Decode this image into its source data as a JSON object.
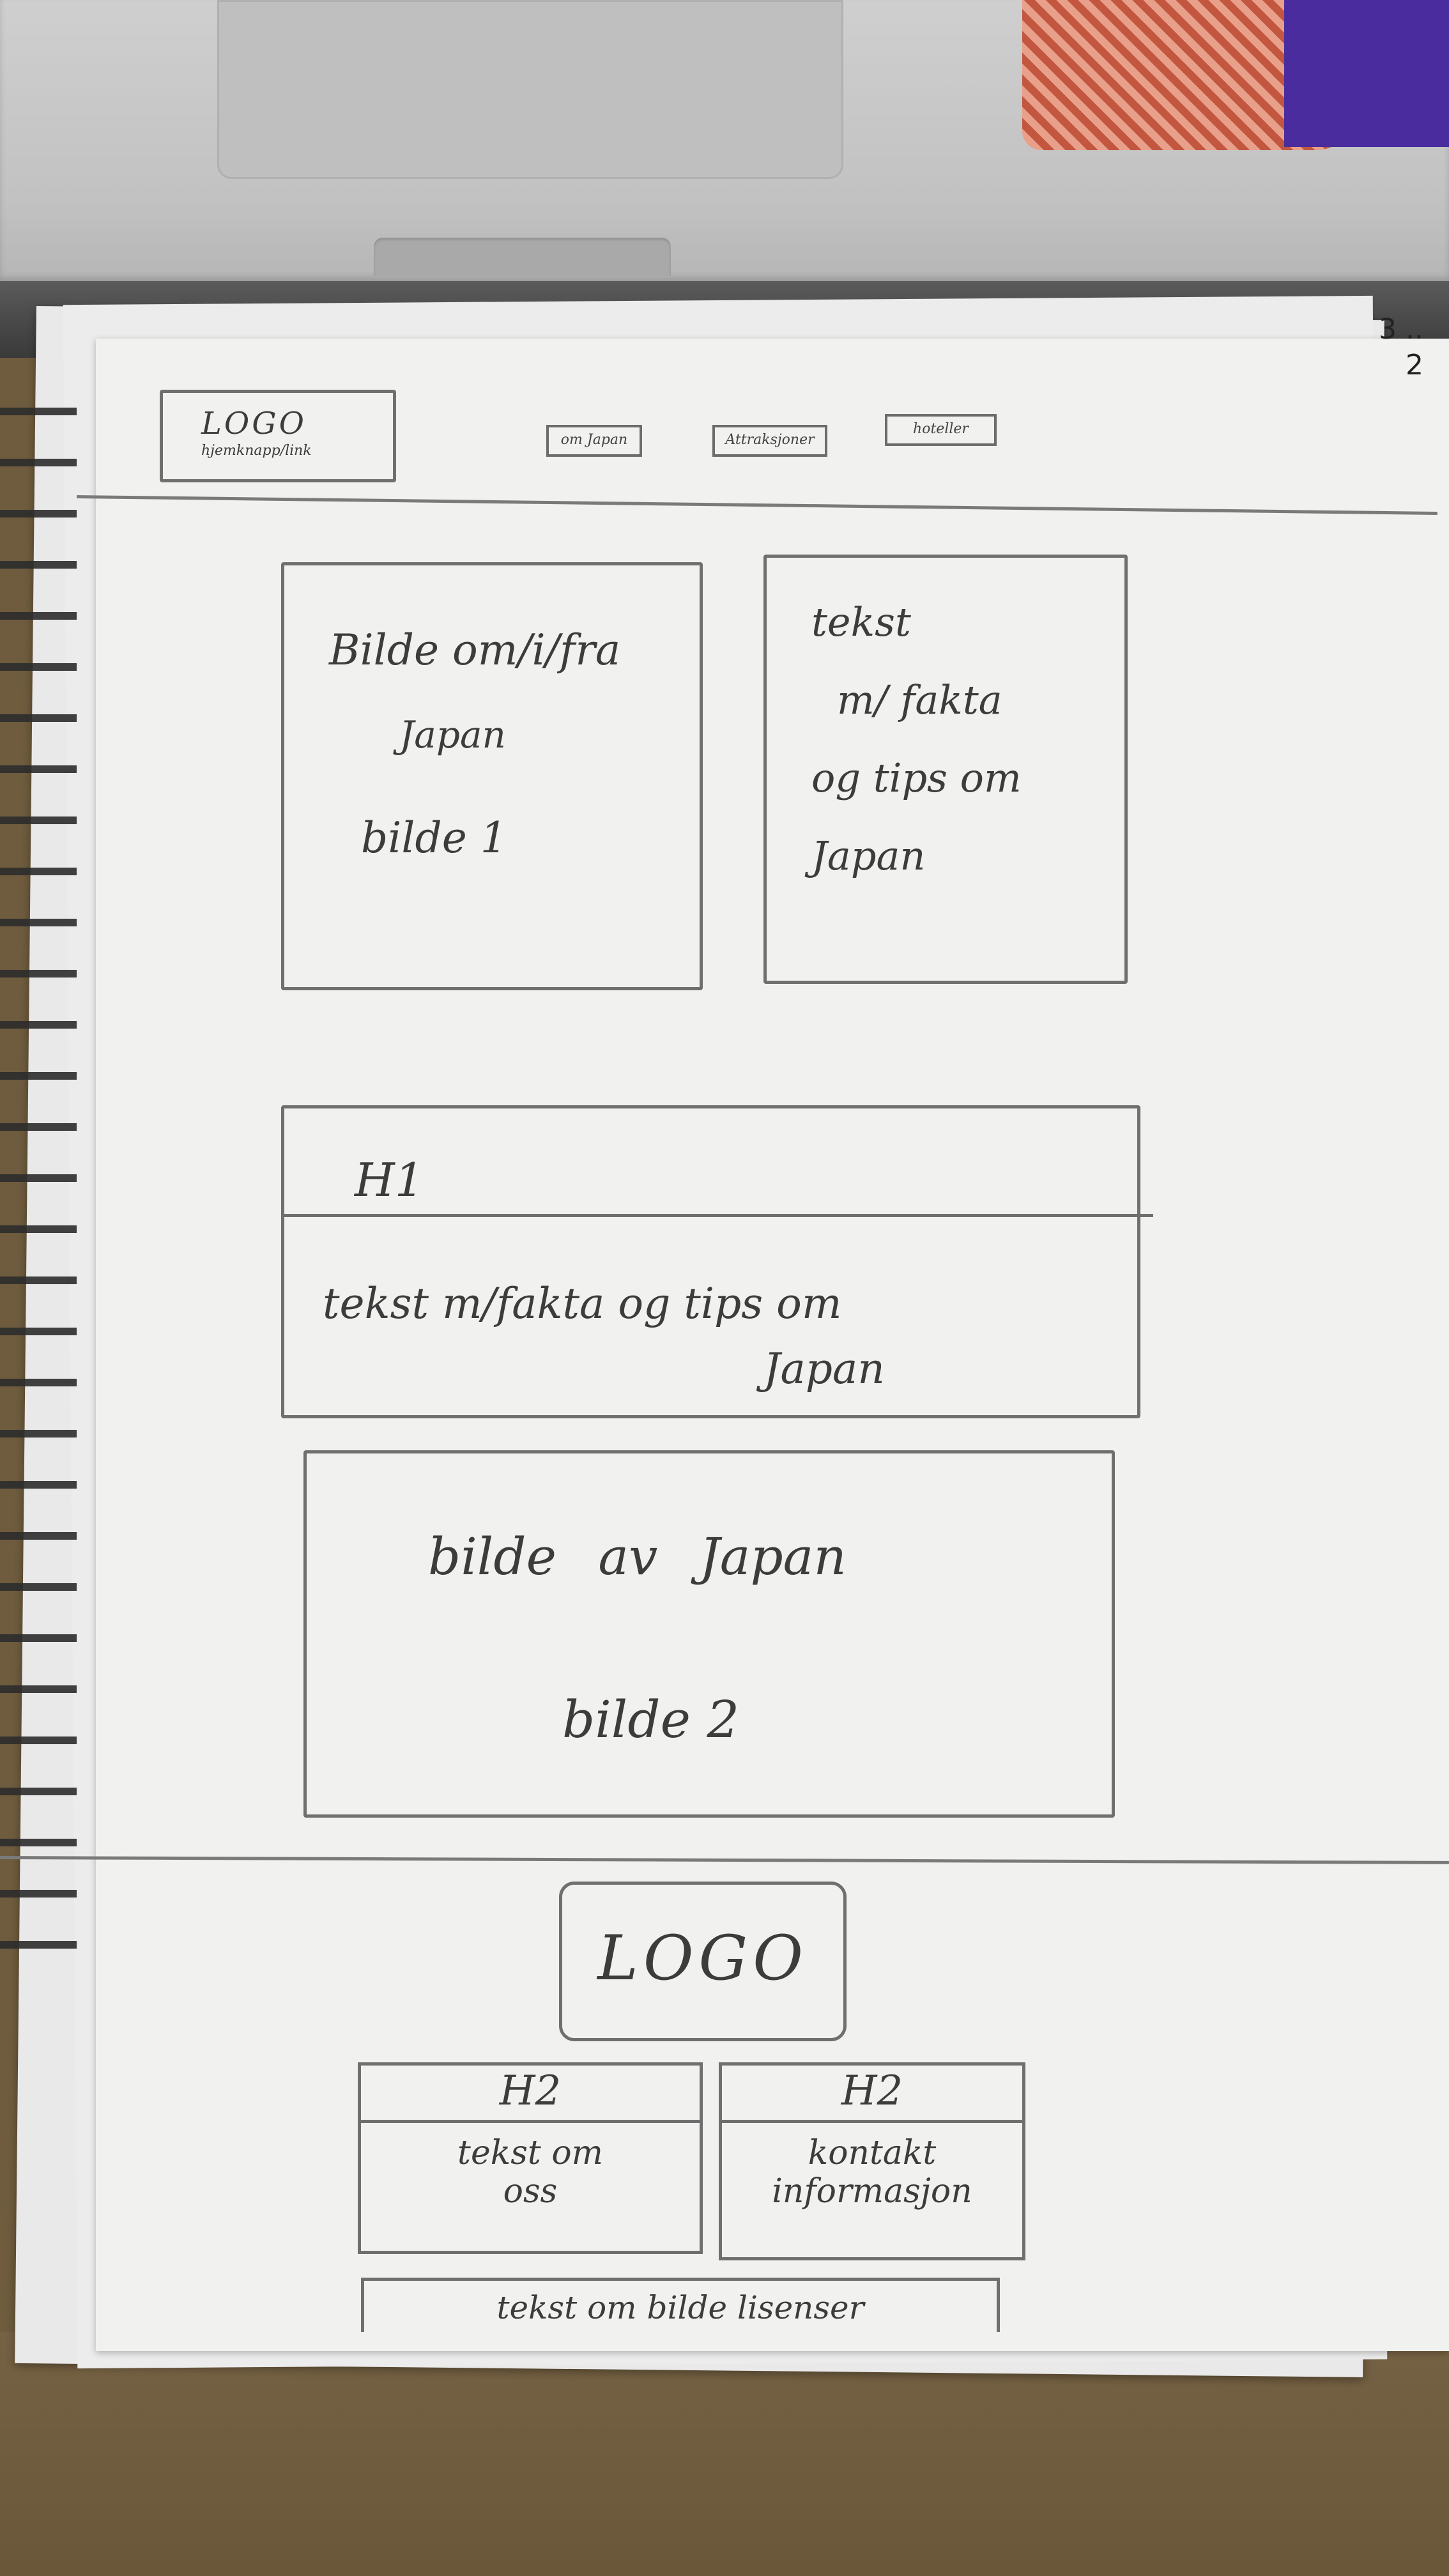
{
  "page_numbers": [
    "3 ..",
    "2"
  ],
  "header": {
    "logo_title": "LOGO",
    "logo_subtitle": "hjemknapp/link",
    "nav": [
      "om Japan",
      "Attraksjoner",
      "hoteller"
    ]
  },
  "main": {
    "image_box_1": {
      "line1": "Bilde om/i/fra",
      "line2": "Japan",
      "line3": "bilde 1"
    },
    "text_box_1": {
      "line1": "tekst",
      "line2": "m/ fakta",
      "line3": "og tips om",
      "line4": "Japan"
    },
    "h1_section": {
      "heading": "H1",
      "text_line1": "tekst  m/fakta og tips om",
      "text_line2": "Japan"
    },
    "image_box_2": {
      "line1": "bilde av Japan",
      "line2": "bilde 2"
    }
  },
  "footer": {
    "logo": "LOGO",
    "columns": [
      {
        "heading": "H2",
        "text_line1": "tekst om",
        "text_line2": "oss"
      },
      {
        "heading": "H2",
        "text_line1": "kontakt",
        "text_line2": "informasjon"
      }
    ],
    "license": "tekst om bilde lisenser"
  },
  "colors": {
    "paper": "#f1f1ef",
    "pencil": "#6f6f6f",
    "table": "#6f5c3e"
  }
}
